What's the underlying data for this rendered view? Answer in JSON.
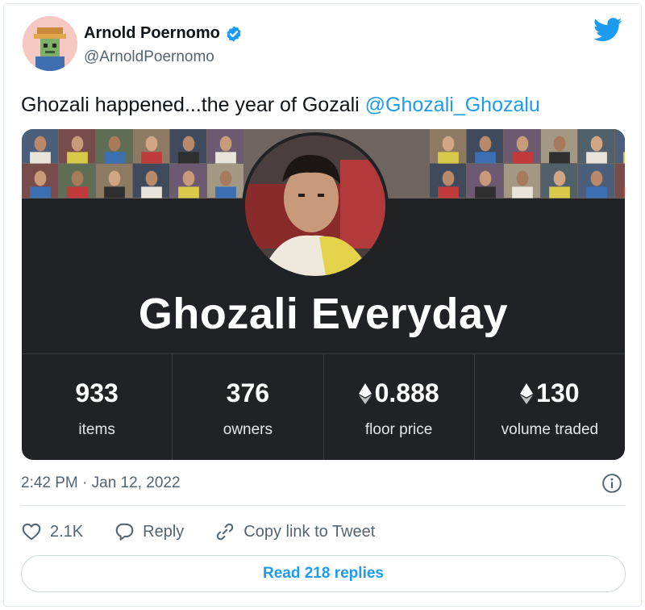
{
  "author": {
    "name": "Arnold Poernomo",
    "handle": "@ArnoldPoernomo",
    "verified_icon": "verified-badge-icon",
    "avatar_color": "#f6c8c2"
  },
  "brand_icon": "twitter-bird-icon",
  "tweet": {
    "text": "Ghozali happened...the year of Gozali ",
    "mention": "@Ghozali_Ghozalu"
  },
  "card": {
    "collection_name": "Ghozali Everyday",
    "stats": [
      {
        "value": "933",
        "label": "items",
        "eth": false
      },
      {
        "value": "376",
        "label": "owners",
        "eth": false
      },
      {
        "value": "0.888",
        "label": "floor price",
        "eth": true
      },
      {
        "value": "130",
        "label": "volume traded",
        "eth": true
      }
    ]
  },
  "timestamp": "2:42 PM · Jan 12, 2022",
  "actions": {
    "likes": "2.1K",
    "reply": "Reply",
    "copy_link": "Copy link to Tweet"
  },
  "read_replies": "Read 218 replies",
  "colors": {
    "accent": "#1d9bf0",
    "card_background": "#202225",
    "muted_text": "#536471"
  }
}
